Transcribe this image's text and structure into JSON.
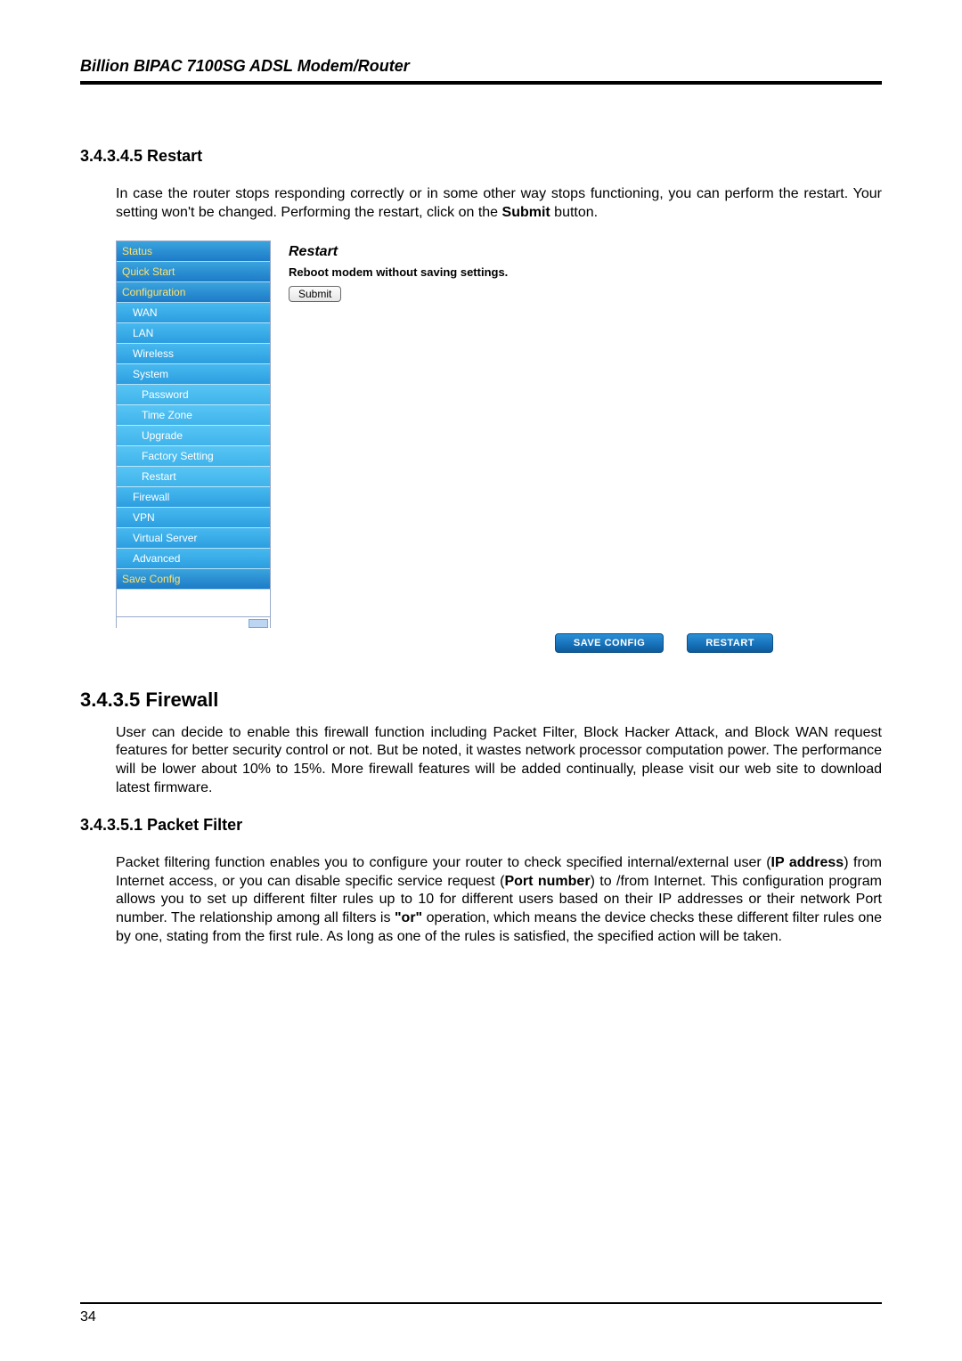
{
  "doc": {
    "header": "Billion BIPAC 7100SG ADSL Modem/Router",
    "page_number": "34",
    "sec_restart_heading": "3.4.3.4.5 Restart",
    "sec_restart_p1_a": "In case the router stops responding correctly or in some other way stops functioning, you can perform the restart. Your setting won't be changed. Performing the restart, click on the ",
    "sec_restart_p1_b_bold": "Submit",
    "sec_restart_p1_c": " button.",
    "sec_firewall_heading": "3.4.3.5 Firewall",
    "sec_firewall_p1": "User can decide to enable this firewall function including Packet Filter, Block Hacker Attack, and Block WAN request features for better security control or not. But be noted, it wastes network processor computation power. The performance will be lower about 10% to 15%. More firewall features will be added continually, please visit our web site to download latest firmware.",
    "sec_pf_heading": "3.4.3.5.1 Packet Filter",
    "pf_p1_a": "Packet filtering function enables you to configure your router to check specified internal/external user (",
    "pf_p1_b_bold": "IP address",
    "pf_p1_c": ") from Internet access, or you can disable specific service request (",
    "pf_p1_d_bold": "Port number",
    "pf_p1_e": ") to /from Internet. This configuration program allows you to set up different filter rules up to 10 for different users based on their IP addresses or their network Port number. The relationship among all filters is ",
    "pf_p1_f_bold": "\"or\"",
    "pf_p1_g": " operation, which means the device checks these different filter rules one by one, stating from the first rule. As long as one of the rules is satisfied, the specified action will be taken."
  },
  "ui": {
    "sidebar": {
      "status": "Status",
      "quick_start": "Quick Start",
      "configuration": "Configuration",
      "wan": "WAN",
      "lan": "LAN",
      "wireless": "Wireless",
      "system": "System",
      "password": "Password",
      "time_zone": "Time Zone",
      "upgrade": "Upgrade",
      "factory_setting": "Factory Setting",
      "restart": "Restart",
      "firewall": "Firewall",
      "vpn": "VPN",
      "virtual_server": "Virtual Server",
      "advanced": "Advanced",
      "save_config": "Save Config"
    },
    "content": {
      "title": "Restart",
      "subtitle": "Reboot modem without saving settings.",
      "submit_label": "Submit"
    },
    "actions": {
      "save_config": "SAVE CONFIG",
      "restart": "RESTART"
    }
  }
}
